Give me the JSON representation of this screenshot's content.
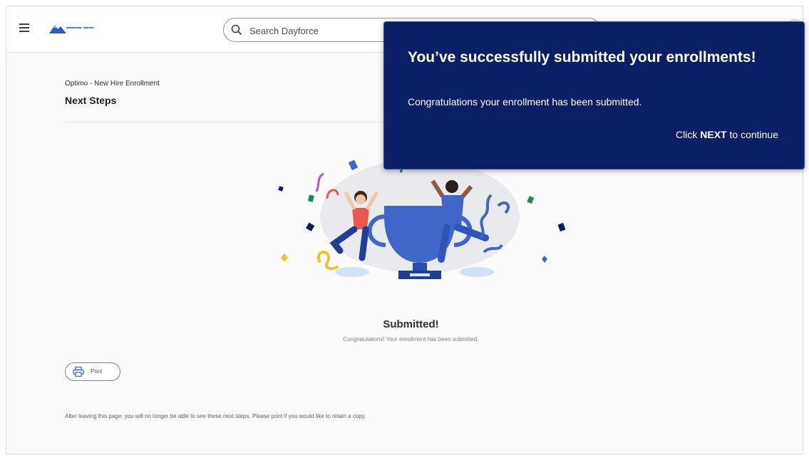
{
  "header": {
    "search_placeholder": "Search Dayforce",
    "logo_icon": "mountain-logo-icon",
    "menu_icon": "hamburger-menu-icon",
    "search_icon": "search-icon",
    "user_icon": "avatar-icon"
  },
  "page": {
    "breadcrumb": "Optimo - New Hire Enrollment",
    "title": "Next Steps"
  },
  "success": {
    "title": "Submitted!",
    "subtitle": "Congratulations! Your enrollment has been submitted."
  },
  "print_button": {
    "label": "Print",
    "icon": "printer-icon"
  },
  "note": "After leaving this page, you will no longer be able to see these next steps. Please print if you would like to retain a copy.",
  "toast": {
    "title": "You’ve successfully submitted your enrollments!",
    "body": "Congratulations your enrollment has been submitted.",
    "cta_prefix": "Click",
    "cta_keyword": "NEXT",
    "cta_suffix": "to continue"
  },
  "colors": {
    "toast_background": "#0b1f66",
    "accent_blue": "#3f66c9",
    "celebrant_red": "#e8584f"
  }
}
